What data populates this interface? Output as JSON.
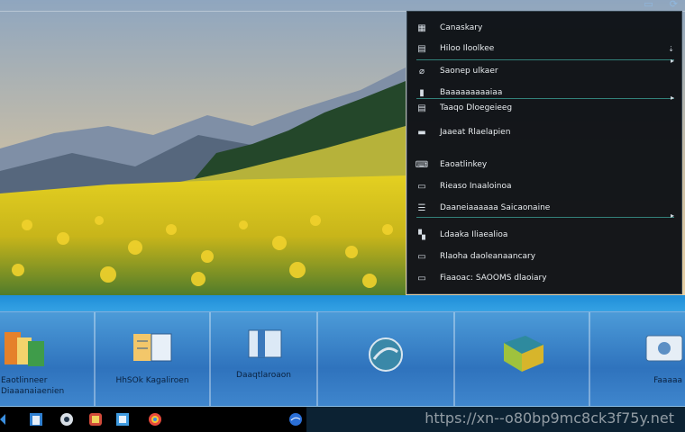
{
  "context_menu": {
    "items": [
      {
        "label": "Canaskary",
        "icon": "grid-icon"
      },
      {
        "label": "Hiloo Iloolkee",
        "icon": "list-icon"
      },
      {
        "label": "Saonep ulkaer",
        "icon": "brush-icon"
      },
      {
        "label": "Baaaaaaaaaiaa",
        "icon": "bar-icon"
      },
      {
        "label": "Taaqo Dloegeieeg",
        "icon": "table-icon"
      },
      {
        "label": "Jaaeat Rlaelapien",
        "icon": "window-icon"
      },
      {
        "label": "Eaoatlinkey",
        "icon": "keyboard-icon"
      },
      {
        "label": "Rieaso Inaaloinoa",
        "icon": "folder-icon"
      },
      {
        "label": "Daaneiaaaaaa Saicaonaine",
        "icon": "menu-lines-icon"
      },
      {
        "label": "Ldaaka Iliaealioa",
        "icon": "chart-icon"
      },
      {
        "label": "Rlaoha daoleanaancary",
        "icon": "tray-icon"
      },
      {
        "label": "Fiaaoac: SAOOMS dlaoiary",
        "icon": "monitor-icon"
      }
    ]
  },
  "tiles": [
    {
      "label": "Eaotlinneer\nDiaaanaiaenien",
      "icon": "documents-icon"
    },
    {
      "label": "HhSOk Kagaliroen",
      "icon": "calendar-icon"
    },
    {
      "label": "Daaqtlaroaon",
      "icon": "window-icon"
    },
    {
      "label": "",
      "icon": "globe-icon"
    },
    {
      "label": "",
      "icon": "puzzle-icon"
    },
    {
      "label": "Faaaaa",
      "icon": "camera-icon"
    }
  ],
  "watermark": "https://xn--o80bp9mc8ck3f75y.net",
  "colors": {
    "accent": "#1f8ed8",
    "menu_bg": "#0c1014",
    "field": "#e7c41f"
  }
}
